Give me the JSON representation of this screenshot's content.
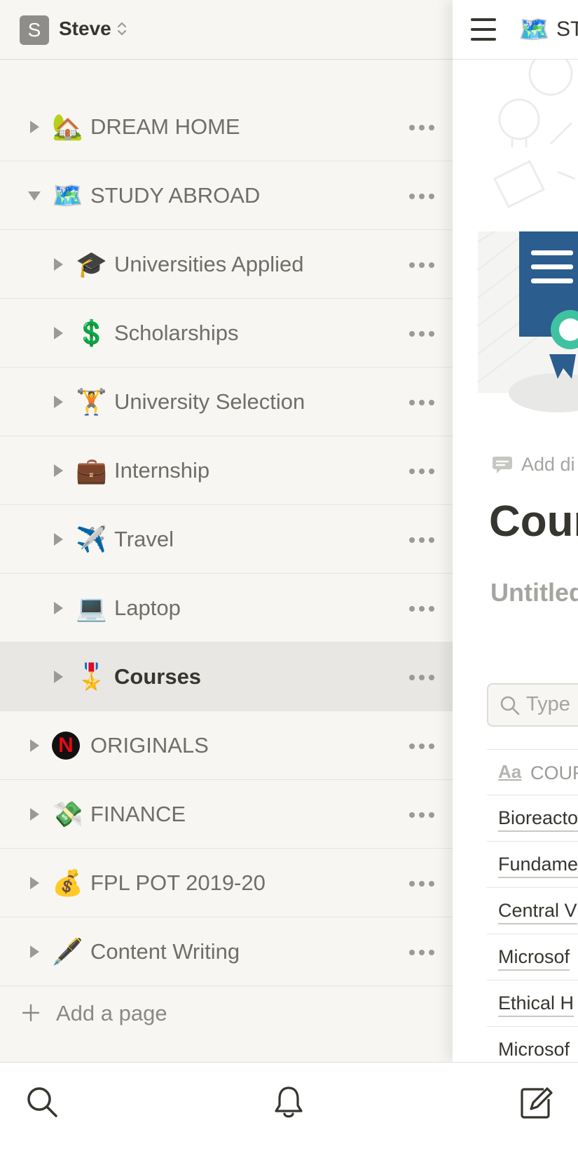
{
  "workspace": {
    "initial": "S",
    "name": "Steve"
  },
  "sidebar": {
    "pages": [
      {
        "label": "DREAM HOME",
        "emoji": "🏡",
        "level": 0,
        "expanded": false,
        "selected": false
      },
      {
        "label": "STUDY ABROAD",
        "emoji": "🗺️",
        "level": 0,
        "expanded": true,
        "selected": false
      },
      {
        "label": "Universities Applied",
        "emoji": "🎓",
        "level": 1,
        "expanded": false,
        "selected": false
      },
      {
        "label": "Scholarships",
        "emoji": "💲",
        "level": 1,
        "expanded": false,
        "selected": false
      },
      {
        "label": "University Selection",
        "emoji": "🏋",
        "level": 1,
        "expanded": false,
        "selected": false
      },
      {
        "label": "Internship",
        "emoji": "💼",
        "level": 1,
        "expanded": false,
        "selected": false
      },
      {
        "label": "Travel",
        "emoji": "✈️",
        "level": 1,
        "expanded": false,
        "selected": false
      },
      {
        "label": "Laptop",
        "emoji": "💻",
        "level": 1,
        "expanded": false,
        "selected": false
      },
      {
        "label": "Courses",
        "emoji": "🎖️",
        "level": 1,
        "expanded": false,
        "selected": true
      },
      {
        "label": "ORIGINALS",
        "emoji": "N",
        "level": 0,
        "expanded": false,
        "selected": false
      },
      {
        "label": "FINANCE",
        "emoji": "💸",
        "level": 0,
        "expanded": false,
        "selected": false
      },
      {
        "label": "FPL POT 2019-20",
        "emoji": "💰",
        "level": 0,
        "expanded": false,
        "selected": false
      },
      {
        "label": "Content Writing",
        "emoji": "🖋️",
        "level": 0,
        "expanded": false,
        "selected": false
      }
    ],
    "add_page_label": "Add a page"
  },
  "main": {
    "breadcrumb": {
      "emoji": "🗺️",
      "text": "ST"
    },
    "add_discussion": "Add di",
    "title": "Cour",
    "view_name": "Untitled",
    "search_placeholder": "Type",
    "table": {
      "header": {
        "icon_text": "Aa",
        "label": "COUR"
      },
      "rows": [
        "Bioreacto",
        "Fundame",
        "Central V",
        "Microsof",
        "Ethical H",
        "Microsof"
      ]
    }
  },
  "tabbar": {
    "icons": [
      "search-icon",
      "bell-icon",
      "compose-icon"
    ]
  },
  "colors": {
    "sidebar_bg": "#f7f6f3",
    "selected_row": "#e8e7e4",
    "text": "#37352f",
    "muted_text": "#6f6e69"
  }
}
